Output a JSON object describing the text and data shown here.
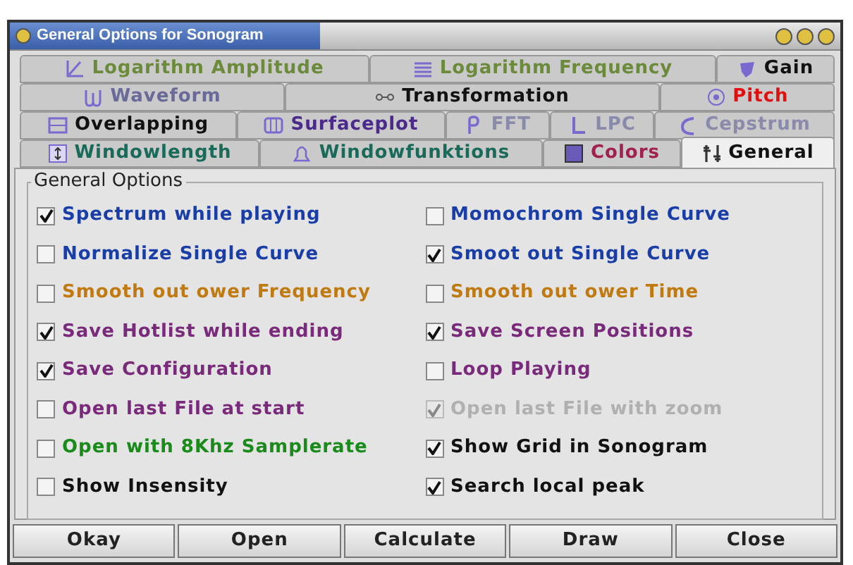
{
  "window": {
    "title": "General Options for Sonogram"
  },
  "tab_rows": [
    [
      {
        "label": "Logarithm Amplitude",
        "color": "#6b8a3a",
        "selected": false
      },
      {
        "label": "Logarithm Frequency",
        "color": "#6b8a3a",
        "selected": false
      },
      {
        "label": "Gain",
        "color": "#111111",
        "selected": false
      }
    ],
    [
      {
        "label": "Waveform",
        "color": "#6a6a9a",
        "selected": false
      },
      {
        "label": "Transformation",
        "color": "#111111",
        "selected": false
      },
      {
        "label": "Pitch",
        "color": "#e01010",
        "selected": false
      }
    ],
    [
      {
        "label": "Overlapping",
        "color": "#111111",
        "selected": false
      },
      {
        "label": "Surfaceplot",
        "color": "#4a2a8a",
        "selected": false
      },
      {
        "label": "FFT",
        "color": "#8a8aaa",
        "selected": false
      },
      {
        "label": "LPC",
        "color": "#8a8aaa",
        "selected": false
      },
      {
        "label": "Cepstrum",
        "color": "#8a8aaa",
        "selected": false
      }
    ],
    [
      {
        "label": "Windowlength",
        "color": "#1a6a5a",
        "selected": false
      },
      {
        "label": "Windowfunktions",
        "color": "#1a6a5a",
        "selected": false
      },
      {
        "label": "Colors",
        "color": "#a02050",
        "selected": false
      },
      {
        "label": "General",
        "color": "#111111",
        "selected": true
      }
    ]
  ],
  "panel": {
    "title": "General Options",
    "options": [
      {
        "label": "Spectrum while playing",
        "checked": true,
        "disabled": false,
        "color": "#1a3ea8"
      },
      {
        "label": "Momochrom Single Curve",
        "checked": false,
        "disabled": false,
        "color": "#1a3ea8"
      },
      {
        "label": "Normalize Single Curve",
        "checked": false,
        "disabled": false,
        "color": "#1a3ea8"
      },
      {
        "label": "Smoot out Single Curve",
        "checked": true,
        "disabled": false,
        "color": "#1a3ea8"
      },
      {
        "label": "Smooth out ower Frequency",
        "checked": false,
        "disabled": false,
        "color": "#c07a10"
      },
      {
        "label": "Smooth out ower Time",
        "checked": false,
        "disabled": false,
        "color": "#c07a10"
      },
      {
        "label": "Save Hotlist while ending",
        "checked": true,
        "disabled": false,
        "color": "#7a2a7a"
      },
      {
        "label": "Save Screen Positions",
        "checked": true,
        "disabled": false,
        "color": "#7a2a7a"
      },
      {
        "label": "Save Configuration",
        "checked": true,
        "disabled": false,
        "color": "#7a2a7a"
      },
      {
        "label": "Loop Playing",
        "checked": false,
        "disabled": false,
        "color": "#7a2a7a"
      },
      {
        "label": "Open last File at start",
        "checked": false,
        "disabled": false,
        "color": "#7a2a7a"
      },
      {
        "label": "Open last File with zoom",
        "checked": true,
        "disabled": true
      },
      {
        "label": "Open with 8Khz Samplerate",
        "checked": false,
        "disabled": false,
        "color": "#1a8a1a"
      },
      {
        "label": "Show Grid in Sonogram",
        "checked": true,
        "disabled": false,
        "color": "#111111"
      },
      {
        "label": "Show Insensity",
        "checked": false,
        "disabled": false,
        "color": "#111111"
      },
      {
        "label": "Search local peak",
        "checked": true,
        "disabled": false,
        "color": "#111111"
      }
    ]
  },
  "buttons": [
    "Okay",
    "Open",
    "Calculate",
    "Draw",
    "Close"
  ]
}
